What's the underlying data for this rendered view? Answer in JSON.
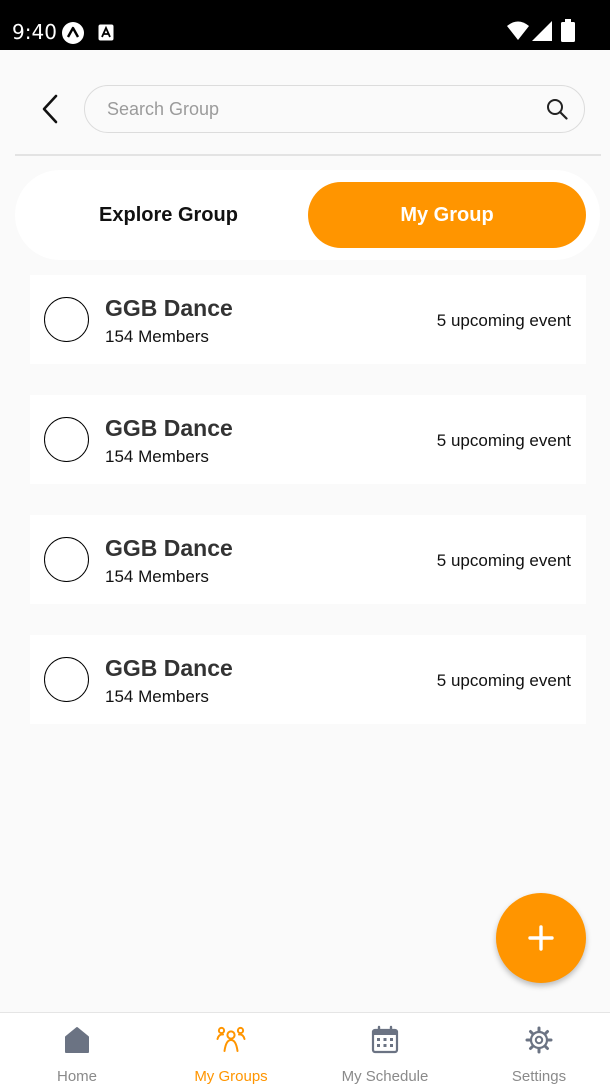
{
  "status_bar": {
    "time": "9:40"
  },
  "header": {
    "search_placeholder": "Search Group"
  },
  "segment": {
    "explore_label": "Explore Group",
    "my_label": "My Group"
  },
  "groups": [
    {
      "name": "GGB Dance",
      "members": "154 Members",
      "events": "5 upcoming event"
    },
    {
      "name": "GGB Dance",
      "members": "154 Members",
      "events": "5 upcoming event"
    },
    {
      "name": "GGB Dance",
      "members": "154 Members",
      "events": "5 upcoming event"
    },
    {
      "name": "GGB Dance",
      "members": "154 Members",
      "events": "5 upcoming event"
    }
  ],
  "bottom_nav": [
    {
      "label": "Home",
      "icon": "home-icon",
      "active": false
    },
    {
      "label": "My Groups",
      "icon": "groups-icon",
      "active": true
    },
    {
      "label": "My Schedule",
      "icon": "calendar-icon",
      "active": false
    },
    {
      "label": "Settings",
      "icon": "gear-icon",
      "active": false
    }
  ],
  "colors": {
    "accent": "#ff9500",
    "nav_inactive": "#6b7383",
    "background": "#fafafa"
  }
}
